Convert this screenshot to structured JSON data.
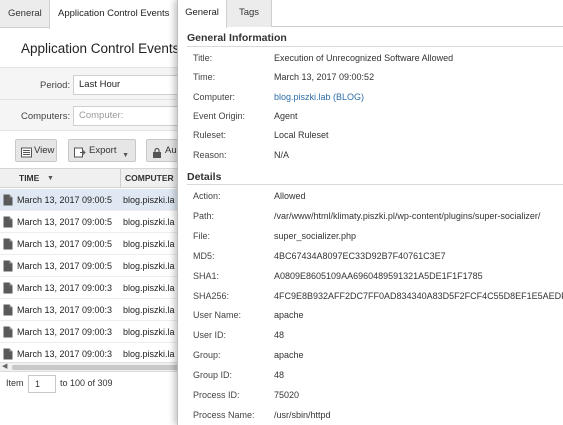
{
  "background": {
    "tabs": [
      "General",
      "Application Control Events"
    ],
    "page_title": "Application Control Events",
    "filters": {
      "period_label": "Period:",
      "period_value": "Last Hour",
      "computers_label": "Computers:",
      "computers_placeholder": "Computer:"
    },
    "toolbar": {
      "view_label": "View",
      "export_label": "Export",
      "aut_label": "Au"
    },
    "grid": {
      "columns": [
        "TIME",
        "COMPUTER"
      ],
      "rows": [
        {
          "time": "March 13, 2017 09:00:5",
          "computer": "blog.piszki.la"
        },
        {
          "time": "March 13, 2017 09:00:5",
          "computer": "blog.piszki.la"
        },
        {
          "time": "March 13, 2017 09:00:5",
          "computer": "blog.piszki.la"
        },
        {
          "time": "March 13, 2017 09:00:5",
          "computer": "blog.piszki.la"
        },
        {
          "time": "March 13, 2017 09:00:3",
          "computer": "blog.piszki.la"
        },
        {
          "time": "March 13, 2017 09:00:3",
          "computer": "blog.piszki.la"
        },
        {
          "time": "March 13, 2017 09:00:3",
          "computer": "blog.piszki.la"
        },
        {
          "time": "March 13, 2017 09:00:3",
          "computer": "blog.piszki.la"
        }
      ]
    },
    "pager": {
      "item_label": "Item",
      "item_value": "1",
      "of_text": "to 100 of 309"
    }
  },
  "panel": {
    "tabs": [
      "General",
      "Tags"
    ],
    "general_heading": "General Information",
    "general": [
      {
        "key": "Title:",
        "value": "Execution of Unrecognized Software Allowed"
      },
      {
        "key": "Time:",
        "value": "March 13, 2017 09:00:52"
      },
      {
        "key": "Computer:",
        "value": "blog.piszki.lab (BLOG)"
      },
      {
        "key": "Event Origin:",
        "value": "Agent"
      },
      {
        "key": "Ruleset:",
        "value": "Local Ruleset"
      },
      {
        "key": "Reason:",
        "value": "N/A"
      }
    ],
    "details_heading": "Details",
    "details": [
      {
        "key": "Action:",
        "value": "Allowed"
      },
      {
        "key": "Path:",
        "value": "/var/www/html/klimaty.piszki.pl/wp-content/plugins/super-socializer/"
      },
      {
        "key": "File:",
        "value": "super_socializer.php"
      },
      {
        "key": "MD5:",
        "value": "4BC67434A8097EC33D92B7F40761C3E7"
      },
      {
        "key": "SHA1:",
        "value": "A0809E8605109AA6960489591321A5DE1F1F1785"
      },
      {
        "key": "SHA256:",
        "value": "4FC9E8B932AFF2DC7FF0AD834340A83D5F2FCF4C55D8EF1E5AEDF5"
      },
      {
        "key": "User Name:",
        "value": "apache"
      },
      {
        "key": "User ID:",
        "value": "48"
      },
      {
        "key": "Group:",
        "value": "apache"
      },
      {
        "key": "Group ID:",
        "value": "48"
      },
      {
        "key": "Process ID:",
        "value": "75020"
      },
      {
        "key": "Process Name:",
        "value": "/usr/sbin/httpd"
      }
    ]
  },
  "colors": {
    "link": "#2f6eaa",
    "selected_row": "#dfe8f3"
  }
}
